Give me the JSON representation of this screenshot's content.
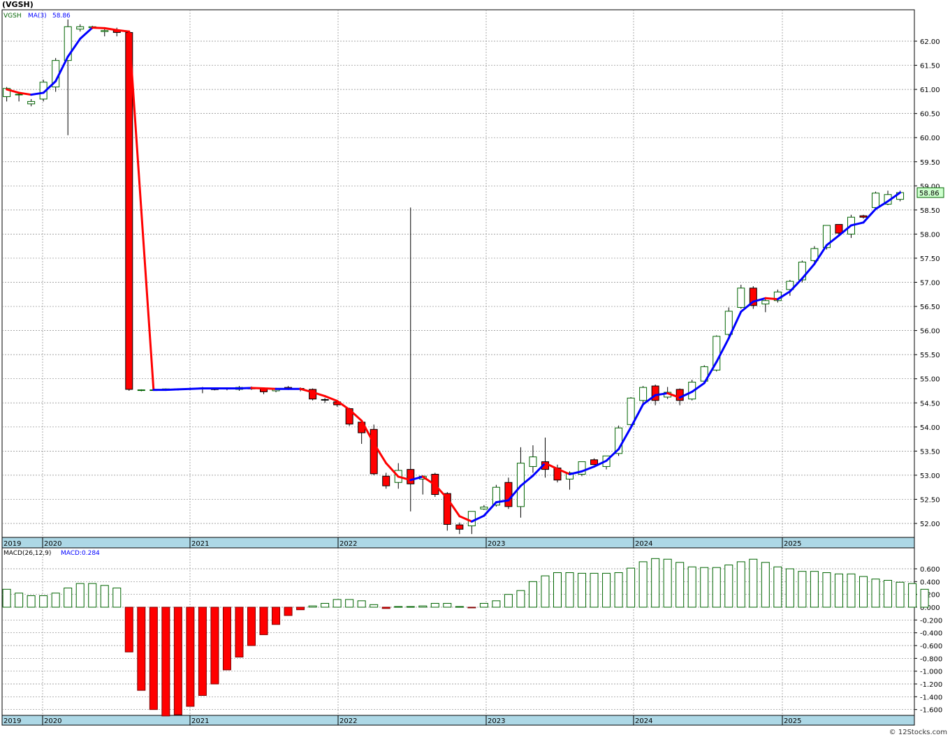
{
  "title": "(VGSH)",
  "footer": "© 12Stocks.com",
  "colors": {
    "up": "#006400",
    "down": "#ff0000",
    "ma_up": "#0000ff",
    "ma_down": "#ff0000",
    "grid": "#888888",
    "axisbar": "#add8e6"
  },
  "price_panel": {
    "legend": {
      "symbol": "VGSH",
      "ma_label": "MA(3)",
      "ma_value": "58.86"
    },
    "last_price": "58.86",
    "y_ticks": [
      "52.00",
      "52.50",
      "53.00",
      "53.50",
      "54.00",
      "54.50",
      "55.00",
      "55.50",
      "56.00",
      "56.50",
      "57.00",
      "57.50",
      "58.00",
      "58.50",
      "59.00",
      "59.50",
      "60.00",
      "60.50",
      "61.00",
      "61.50",
      "62.00"
    ]
  },
  "macd_panel": {
    "legend": {
      "label": "MACD(26,12,9)",
      "value_label": "MACD:0.284"
    },
    "y_ticks": [
      "0.600",
      "0.400",
      "0.200",
      "0.000",
      "-0.200",
      "-0.400",
      "-0.600",
      "-0.800",
      "-1.000",
      "-1.200",
      "-1.400",
      "-1.600"
    ]
  },
  "x_labels": [
    "2019",
    "2020",
    "2021",
    "2022",
    "2023",
    "2024",
    "2025"
  ],
  "chart_data": {
    "type": "candlestick",
    "title": "(VGSH)",
    "x_unit": "month",
    "start_month": "2019-10",
    "candles": [
      {
        "o": 60.85,
        "h": 61.05,
        "l": 60.75,
        "c": 61.02
      },
      {
        "o": 60.9,
        "h": 60.95,
        "l": 60.75,
        "c": 60.9
      },
      {
        "o": 60.7,
        "h": 60.8,
        "l": 60.65,
        "c": 60.75
      },
      {
        "o": 60.8,
        "h": 61.2,
        "l": 60.75,
        "c": 61.15
      },
      {
        "o": 61.05,
        "h": 61.65,
        "l": 60.95,
        "c": 61.6
      },
      {
        "o": 61.6,
        "h": 62.45,
        "l": 60.05,
        "c": 62.3
      },
      {
        "o": 62.25,
        "h": 62.35,
        "l": 62.2,
        "c": 62.3
      },
      {
        "o": 62.28,
        "h": 62.32,
        "l": 62.25,
        "c": 62.3
      },
      {
        "o": 62.2,
        "h": 62.25,
        "l": 62.1,
        "c": 62.22
      },
      {
        "o": 62.22,
        "h": 62.28,
        "l": 62.1,
        "c": 62.18
      },
      {
        "o": 62.18,
        "h": 62.2,
        "l": 54.75,
        "c": 54.78
      },
      {
        "o": 54.76,
        "h": 54.78,
        "l": 54.74,
        "c": 54.77
      },
      {
        "o": 54.77,
        "h": 54.78,
        "l": 54.76,
        "c": 54.77
      },
      {
        "o": 54.76,
        "h": 54.8,
        "l": 54.75,
        "c": 54.79
      },
      {
        "o": 54.78,
        "h": 54.8,
        "l": 54.76,
        "c": 54.79
      },
      {
        "o": 54.79,
        "h": 54.81,
        "l": 54.77,
        "c": 54.8
      },
      {
        "o": 54.8,
        "h": 54.83,
        "l": 54.7,
        "c": 54.81
      },
      {
        "o": 54.79,
        "h": 54.81,
        "l": 54.76,
        "c": 54.78
      },
      {
        "o": 54.79,
        "h": 54.82,
        "l": 54.76,
        "c": 54.8
      },
      {
        "o": 54.78,
        "h": 54.85,
        "l": 54.75,
        "c": 54.82
      },
      {
        "o": 54.81,
        "h": 54.84,
        "l": 54.77,
        "c": 54.79
      },
      {
        "o": 54.79,
        "h": 54.82,
        "l": 54.68,
        "c": 54.73
      },
      {
        "o": 54.75,
        "h": 54.81,
        "l": 54.72,
        "c": 54.8
      },
      {
        "o": 54.82,
        "h": 54.85,
        "l": 54.78,
        "c": 54.8
      },
      {
        "o": 54.8,
        "h": 54.82,
        "l": 54.74,
        "c": 54.78
      },
      {
        "o": 54.78,
        "h": 54.8,
        "l": 54.55,
        "c": 54.58
      },
      {
        "o": 54.57,
        "h": 54.6,
        "l": 54.5,
        "c": 54.56
      },
      {
        "o": 54.52,
        "h": 54.55,
        "l": 54.42,
        "c": 54.46
      },
      {
        "o": 54.38,
        "h": 54.4,
        "l": 54.02,
        "c": 54.06
      },
      {
        "o": 54.1,
        "h": 54.15,
        "l": 53.65,
        "c": 53.88
      },
      {
        "o": 53.95,
        "h": 54.05,
        "l": 53.0,
        "c": 53.03
      },
      {
        "o": 52.98,
        "h": 53.05,
        "l": 52.72,
        "c": 52.78
      },
      {
        "o": 52.85,
        "h": 53.25,
        "l": 52.72,
        "c": 53.1
      },
      {
        "o": 53.12,
        "h": 58.55,
        "l": 52.25,
        "c": 52.82
      },
      {
        "o": 52.92,
        "h": 53.0,
        "l": 52.6,
        "c": 52.98
      },
      {
        "o": 53.02,
        "h": 53.05,
        "l": 52.55,
        "c": 52.6
      },
      {
        "o": 52.62,
        "h": 52.65,
        "l": 51.85,
        "c": 51.98
      },
      {
        "o": 51.97,
        "h": 52.02,
        "l": 51.78,
        "c": 51.88
      },
      {
        "o": 51.95,
        "h": 52.25,
        "l": 51.78,
        "c": 52.25
      },
      {
        "o": 52.3,
        "h": 52.38,
        "l": 52.28,
        "c": 52.34
      },
      {
        "o": 52.38,
        "h": 52.8,
        "l": 52.35,
        "c": 52.75
      },
      {
        "o": 52.85,
        "h": 52.95,
        "l": 52.3,
        "c": 52.35
      },
      {
        "o": 52.35,
        "h": 53.58,
        "l": 52.12,
        "c": 53.25
      },
      {
        "o": 53.18,
        "h": 53.62,
        "l": 53.05,
        "c": 53.38
      },
      {
        "o": 53.28,
        "h": 53.78,
        "l": 52.95,
        "c": 53.12
      },
      {
        "o": 53.15,
        "h": 53.22,
        "l": 52.85,
        "c": 52.9
      },
      {
        "o": 52.92,
        "h": 53.08,
        "l": 52.7,
        "c": 53.05
      },
      {
        "o": 53.02,
        "h": 53.28,
        "l": 52.98,
        "c": 53.28
      },
      {
        "o": 53.32,
        "h": 53.35,
        "l": 53.22,
        "c": 53.22
      },
      {
        "o": 53.18,
        "h": 53.4,
        "l": 53.12,
        "c": 53.4
      },
      {
        "o": 53.45,
        "h": 54.03,
        "l": 53.4,
        "c": 53.98
      },
      {
        "o": 54.05,
        "h": 54.62,
        "l": 54.03,
        "c": 54.6
      },
      {
        "o": 54.55,
        "h": 54.85,
        "l": 54.5,
        "c": 54.82
      },
      {
        "o": 54.85,
        "h": 54.88,
        "l": 54.45,
        "c": 54.55
      },
      {
        "o": 54.62,
        "h": 54.83,
        "l": 54.58,
        "c": 54.72
      },
      {
        "o": 54.78,
        "h": 54.8,
        "l": 54.45,
        "c": 54.55
      },
      {
        "o": 54.58,
        "h": 54.98,
        "l": 54.55,
        "c": 54.93
      },
      {
        "o": 54.95,
        "h": 55.28,
        "l": 54.92,
        "c": 55.25
      },
      {
        "o": 55.18,
        "h": 55.9,
        "l": 55.15,
        "c": 55.88
      },
      {
        "o": 55.92,
        "h": 56.48,
        "l": 55.88,
        "c": 56.4
      },
      {
        "o": 56.48,
        "h": 56.95,
        "l": 56.45,
        "c": 56.88
      },
      {
        "o": 56.88,
        "h": 56.92,
        "l": 56.45,
        "c": 56.52
      },
      {
        "o": 56.55,
        "h": 56.68,
        "l": 56.38,
        "c": 56.62
      },
      {
        "o": 56.62,
        "h": 56.85,
        "l": 56.58,
        "c": 56.8
      },
      {
        "o": 56.85,
        "h": 57.05,
        "l": 56.72,
        "c": 57.02
      },
      {
        "o": 57.05,
        "h": 57.45,
        "l": 57.0,
        "c": 57.42
      },
      {
        "o": 57.45,
        "h": 57.75,
        "l": 57.4,
        "c": 57.7
      },
      {
        "o": 57.72,
        "h": 58.18,
        "l": 57.68,
        "c": 58.18
      },
      {
        "o": 58.2,
        "h": 58.2,
        "l": 57.98,
        "c": 58.02
      },
      {
        "o": 58.0,
        "h": 58.4,
        "l": 57.92,
        "c": 58.35
      },
      {
        "o": 58.38,
        "h": 58.4,
        "l": 58.32,
        "c": 58.35
      },
      {
        "o": 58.55,
        "h": 58.88,
        "l": 58.5,
        "c": 58.85
      },
      {
        "o": 58.62,
        "h": 58.9,
        "l": 58.6,
        "c": 58.82
      },
      {
        "o": 58.72,
        "h": 58.9,
        "l": 58.68,
        "c": 58.86
      }
    ],
    "ma3": [
      61.0,
      60.93,
      60.89,
      60.93,
      61.17,
      61.68,
      62.05,
      62.28,
      62.27,
      62.23,
      62.2,
      null,
      54.77,
      54.77,
      54.78,
      54.79,
      54.8,
      54.8,
      54.8,
      54.8,
      54.81,
      54.8,
      54.79,
      54.79,
      54.79,
      54.72,
      54.64,
      54.54,
      54.36,
      54.13,
      53.66,
      53.25,
      52.97,
      52.9,
      52.97,
      52.8,
      52.52,
      52.15,
      52.04,
      52.16,
      52.44,
      52.48,
      52.78,
      52.99,
      53.25,
      53.13,
      53.02,
      53.08,
      53.18,
      53.3,
      53.54,
      53.99,
      54.47,
      54.66,
      54.7,
      54.61,
      54.73,
      54.91,
      55.35,
      55.84,
      56.39,
      56.6,
      56.67,
      56.65,
      56.81,
      57.08,
      57.38,
      57.77,
      57.97,
      58.18,
      58.24,
      58.52,
      58.68,
      58.86
    ],
    "macd": [
      0.28,
      0.22,
      0.18,
      0.18,
      0.22,
      0.3,
      0.37,
      0.37,
      0.34,
      0.3,
      -0.7,
      -1.3,
      -1.6,
      -1.7,
      -1.68,
      -1.55,
      -1.38,
      -1.2,
      -0.98,
      -0.78,
      -0.6,
      -0.43,
      -0.27,
      -0.13,
      -0.04,
      0.02,
      0.06,
      0.12,
      0.12,
      0.1,
      0.04,
      -0.02,
      0.01,
      0.01,
      0.02,
      0.06,
      0.06,
      0.01,
      -0.01,
      0.06,
      0.1,
      0.2,
      0.26,
      0.4,
      0.49,
      0.54,
      0.54,
      0.53,
      0.53,
      0.53,
      0.54,
      0.61,
      0.71,
      0.76,
      0.75,
      0.7,
      0.63,
      0.62,
      0.62,
      0.66,
      0.71,
      0.75,
      0.7,
      0.63,
      0.6,
      0.56,
      0.56,
      0.54,
      0.52,
      0.52,
      0.48,
      0.44,
      0.42,
      0.39,
      0.37,
      0.28
    ]
  }
}
